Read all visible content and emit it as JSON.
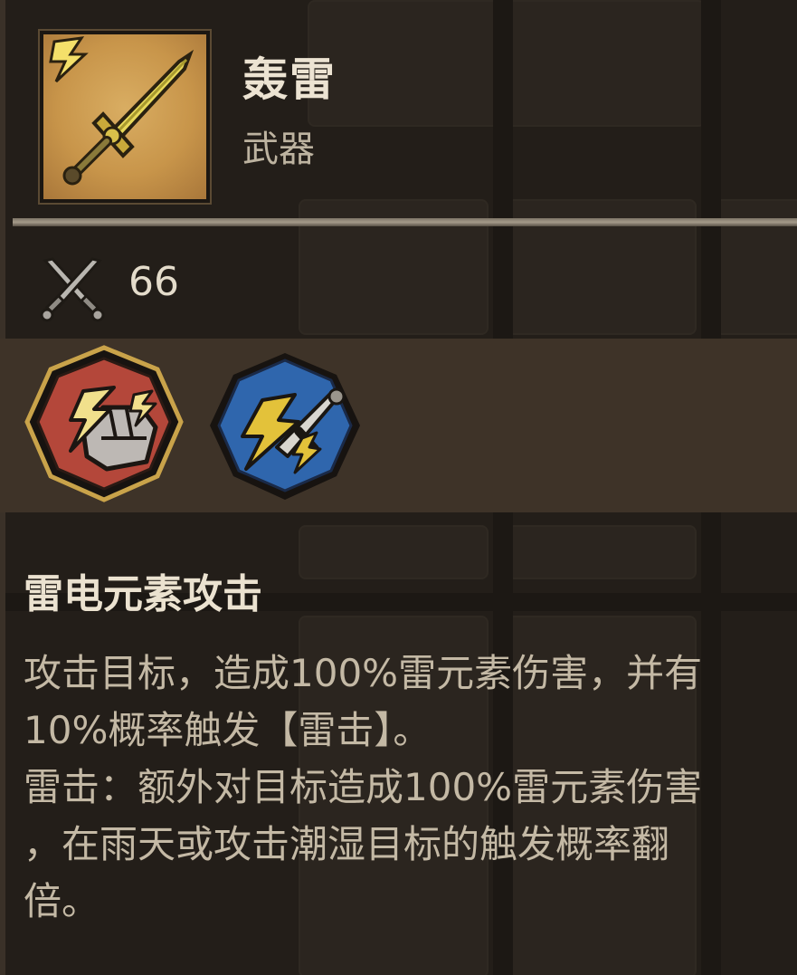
{
  "item": {
    "name": "轰雷",
    "type": "武器",
    "icon": "lightning-sword-icon"
  },
  "stats": {
    "attack_icon": "crossed-swords-icon",
    "attack": "66"
  },
  "skills": [
    {
      "icon": "thunder-fist-icon",
      "color": "#b4473a",
      "selected": true
    },
    {
      "icon": "lightning-sword-skill-icon",
      "color": "#2f66ad",
      "selected": false
    }
  ],
  "description": {
    "title": "雷电元素攻击",
    "line1": "攻击目标，造成100%雷元素伤害，并有",
    "line2": "10%概率触发【雷击】。",
    "line3": "雷击：额外对目标造成100%雷元素伤害",
    "line4": "，在雨天或攻击潮湿目标的触发概率翻",
    "line5": "倍。"
  },
  "colors": {
    "background": "#231e19",
    "band": "#3e3328",
    "gold": "#d6b24a"
  }
}
